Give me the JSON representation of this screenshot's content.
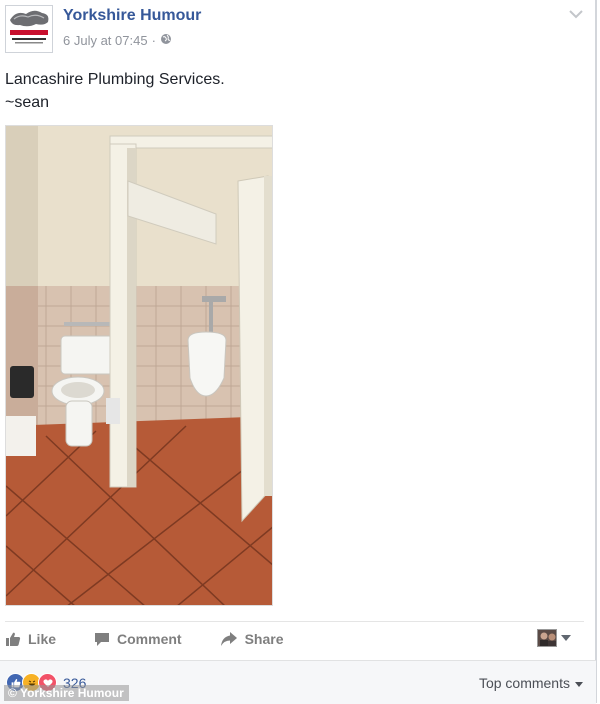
{
  "post": {
    "page_name": "Yorkshire Humour",
    "avatar_text": "Yorkshire Bred",
    "timestamp": "6 July at 07:45",
    "separator": "·",
    "audience_icon": "globe-icon",
    "text_lines": [
      "Lancashire Plumbing Services.",
      "~sean"
    ]
  },
  "photo": {
    "description_icon": "bathroom-photo"
  },
  "actions": {
    "like_label": "Like",
    "comment_label": "Comment",
    "share_label": "Share"
  },
  "reactions": {
    "types": [
      "like-icon",
      "haha-icon",
      "love-icon"
    ],
    "count": "326"
  },
  "comments": {
    "sort_label": "Top comments"
  },
  "watermark": {
    "text": "© Yorkshire Humour"
  },
  "colors": {
    "link_blue": "#365899",
    "meta_grey": "#90949c",
    "action_grey": "#7f7f7f",
    "like_blue": "#4267b2",
    "love_red": "#f25268",
    "haha_yellow": "#f7b125"
  }
}
